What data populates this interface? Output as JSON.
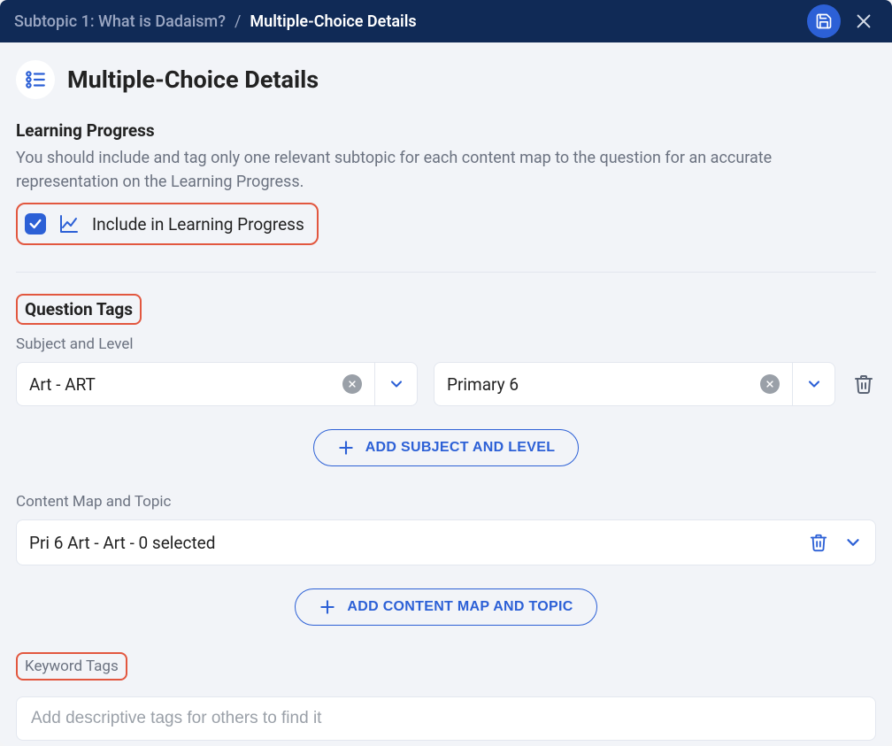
{
  "breadcrumb": {
    "parent": "Subtopic 1: What is Dadaism?",
    "separator": "/",
    "current": "Multiple-Choice Details"
  },
  "page": {
    "title": "Multiple-Choice Details"
  },
  "learningProgress": {
    "title": "Learning Progress",
    "description": "You should include and tag only one relevant subtopic for each content map to the question for an accurate representation on the Learning Progress.",
    "checkboxLabel": "Include in Learning Progress",
    "checked": true
  },
  "questionTags": {
    "title": "Question Tags",
    "subjectLevelLabel": "Subject and Level",
    "subject": "Art - ART",
    "level": "Primary 6",
    "addSubjectLabel": "ADD SUBJECT AND LEVEL",
    "contentMapLabel": "Content Map and Topic",
    "contentMapValue": "Pri 6 Art - Art - 0 selected",
    "addContentMapLabel": "ADD CONTENT MAP AND TOPIC"
  },
  "keywordTags": {
    "title": "Keyword Tags",
    "placeholder": "Add descriptive tags for others to find it"
  }
}
